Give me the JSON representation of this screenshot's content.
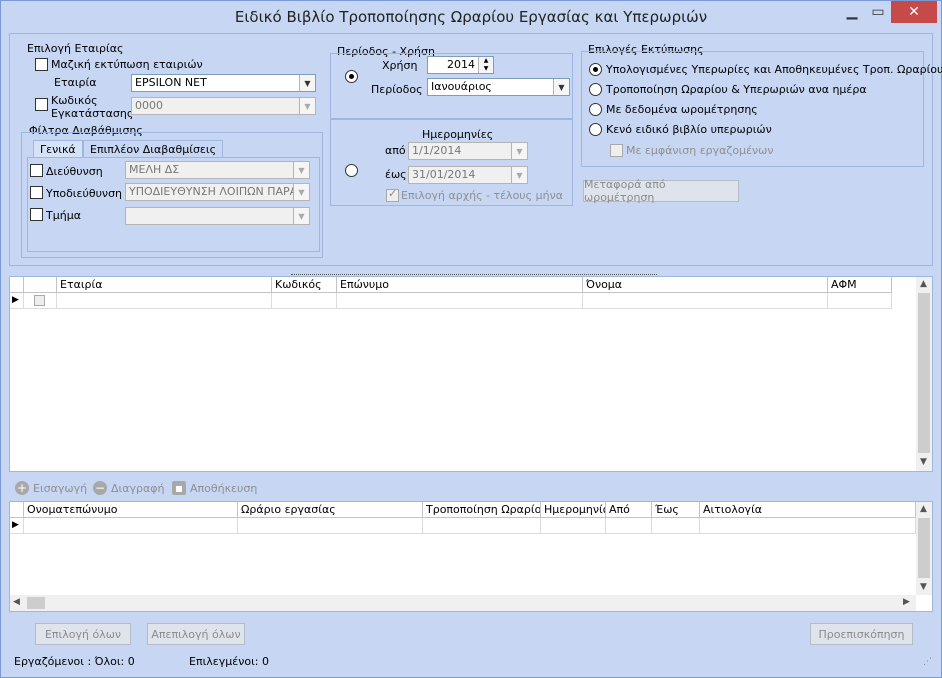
{
  "window": {
    "title": "Ειδικό Βιβλίο Τροποποίησης Ωραρίου Εργασίας και Υπερωριών"
  },
  "company": {
    "group_label": "Επιλογή Εταιρίας",
    "bulk_print_label": "Μαζική εκτύπωση εταιριών",
    "company_label": "Εταιρία",
    "company_value": "EPSILON NET",
    "install_code_label_1": "Κωδικός",
    "install_code_label_2": "Εγκατάστασης",
    "install_code_value": "0000"
  },
  "filters": {
    "group_label": "Φίλτρα Διαβάθμισης",
    "tab_general": "Γενικά",
    "tab_more": "Επιπλέον Διαβαθμίσεις",
    "direction_label": "Διεύθυνση",
    "direction_value": "ΜΕΛΗ ΔΣ",
    "subdirection_label": "Υποδιεύθυνση",
    "subdirection_value": "ΥΠΟΔΙΕΥΘΥΝΣΗ ΛΟΙΠΩΝ ΠΑΡΑΜ",
    "department_label": "Τμήμα",
    "department_value": ""
  },
  "period": {
    "group_label": "Περίοδος - Χρήση",
    "year_label": "Χρήση",
    "year_value": "2014",
    "period_label": "Περίοδος",
    "period_value": "Ιανουάριος",
    "dates_label": "Ημερομηνίες",
    "from_label": "από",
    "from_value": "1/1/2014",
    "to_label": "έως",
    "to_value": "31/01/2014",
    "month_bounds_label": "Επιλογή αρχής - τέλους μήνα"
  },
  "print_options": {
    "group_label": "Επιλογές Εκτύπωσης",
    "opt1": "Υπολογισμένες Υπερωρίες και Αποθηκευμένες Τροπ. Ωραρίου",
    "opt2": "Τροποποίηση Ωραρίου & Υπερωριών ανα ημέρα",
    "opt3": "Με δεδομένα ωρομέτρησης",
    "opt4": "Κενό ειδικό βιβλίο υπερωριών",
    "show_employees_label": "Με εμφάνιση εργαζομένων",
    "transfer_button": "Μεταφορά από ωρομέτρηση"
  },
  "employees_grid": {
    "columns": [
      "Εταιρία",
      "Κωδικός",
      "Επώνυμο",
      "Όνομα",
      "ΑΦΜ"
    ]
  },
  "toolbar": {
    "insert": "Εισαγωγή",
    "delete": "Διαγραφή",
    "save": "Αποθήκευση"
  },
  "details_grid": {
    "columns": [
      "Ονοματεπώνυμο",
      "Ωράριο εργασίας",
      "Τροποποίηση  Ωραρίου",
      "Ημερομηνία",
      "Από",
      "Έως",
      "Αιτιολογία"
    ]
  },
  "bottom_buttons": {
    "select_all": "Επιλογή όλων",
    "deselect_all": "Απεπιλογή όλων",
    "preview": "Προεπισκόπηση"
  },
  "status": {
    "employees_all": "Εργαζόμενοι :  Όλοι: 0",
    "selected": "Επιλεγμένοι: 0"
  }
}
